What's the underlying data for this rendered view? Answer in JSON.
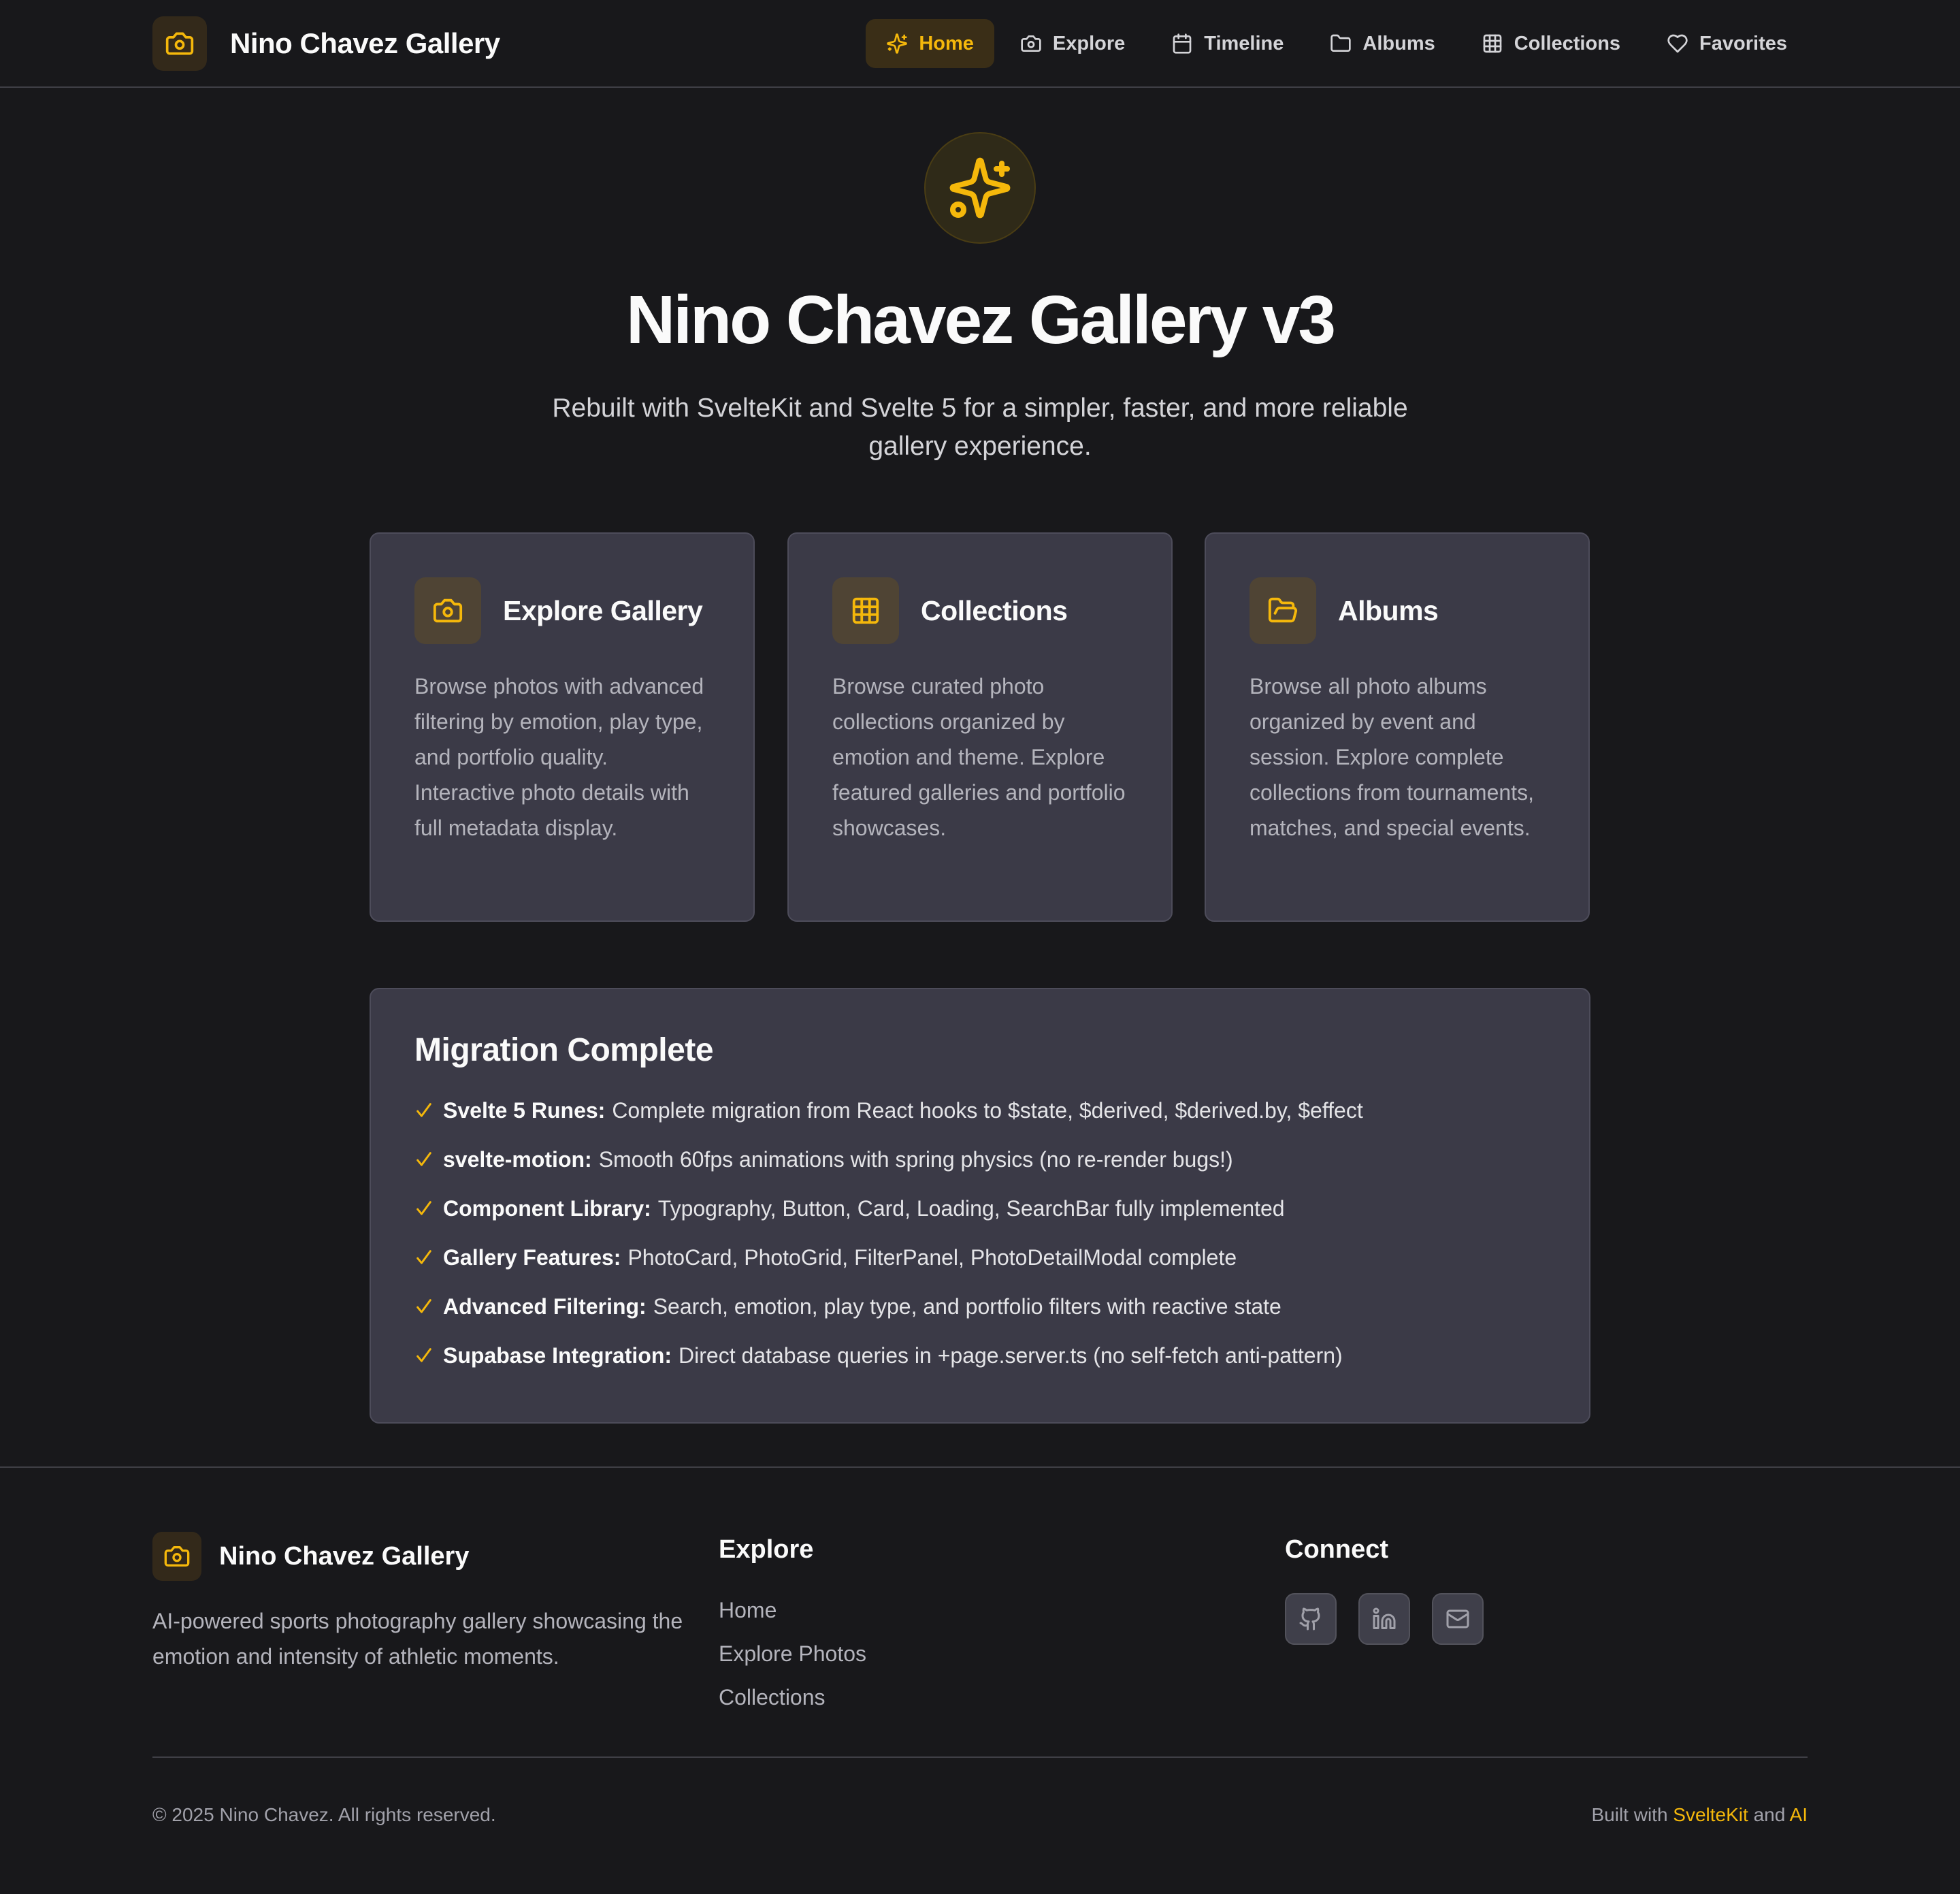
{
  "header": {
    "brand_title": "Nino Chavez Gallery",
    "nav": [
      {
        "label": "Home",
        "icon": "sparkles-icon",
        "active": true
      },
      {
        "label": "Explore",
        "icon": "camera-icon"
      },
      {
        "label": "Timeline",
        "icon": "calendar-icon"
      },
      {
        "label": "Albums",
        "icon": "folder-icon"
      },
      {
        "label": "Collections",
        "icon": "grid-icon"
      },
      {
        "label": "Favorites",
        "icon": "heart-icon"
      }
    ]
  },
  "hero": {
    "icon": "sparkles-icon",
    "title": "Nino Chavez Gallery v3",
    "subtitle": "Rebuilt with SvelteKit and Svelte 5 for a simpler, faster, and more reliable gallery experience."
  },
  "cards": [
    {
      "title": "Explore Gallery",
      "icon": "camera-icon",
      "description": "Browse photos with advanced filtering by emotion, play type, and portfolio quality. Interactive photo details with full metadata display."
    },
    {
      "title": "Collections",
      "icon": "grid-icon",
      "description": "Browse curated photo collections organized by emotion and theme. Explore featured galleries and portfolio showcases."
    },
    {
      "title": "Albums",
      "icon": "folder-open-icon",
      "description": "Browse all photo albums organized by event and session. Explore complete collections from tournaments, matches, and special events."
    }
  ],
  "migration": {
    "title": "Migration Complete",
    "items": [
      {
        "label": "Svelte 5 Runes:",
        "text": "Complete migration from React hooks to $state, $derived, $derived.by, $effect"
      },
      {
        "label": "svelte-motion:",
        "text": "Smooth 60fps animations with spring physics (no re-render bugs!)"
      },
      {
        "label": "Component Library:",
        "text": "Typography, Button, Card, Loading, SearchBar fully implemented"
      },
      {
        "label": "Gallery Features:",
        "text": "PhotoCard, PhotoGrid, FilterPanel, PhotoDetailModal complete"
      },
      {
        "label": "Advanced Filtering:",
        "text": "Search, emotion, play type, and portfolio filters with reactive state"
      },
      {
        "label": "Supabase Integration:",
        "text": "Direct database queries in +page.server.ts (no self-fetch anti-pattern)"
      }
    ]
  },
  "footer": {
    "brand_title": "Nino Chavez Gallery",
    "description": "AI-powered sports photography gallery showcasing the emotion and intensity of athletic moments.",
    "explore_title": "Explore",
    "explore_links": [
      "Home",
      "Explore Photos",
      "Collections"
    ],
    "connect_title": "Connect",
    "socials": [
      "github-icon",
      "linkedin-icon",
      "mail-icon"
    ],
    "copyright": "© 2025 Nino Chavez. All rights reserved.",
    "built_prefix": "Built with",
    "built_tech": "SvelteKit",
    "built_and": "and",
    "built_ai": "AI"
  },
  "colors": {
    "background": "#18181b",
    "surface": "#3b3a47",
    "accent": "#f5b80b",
    "text_muted": "#b4b4bc"
  }
}
